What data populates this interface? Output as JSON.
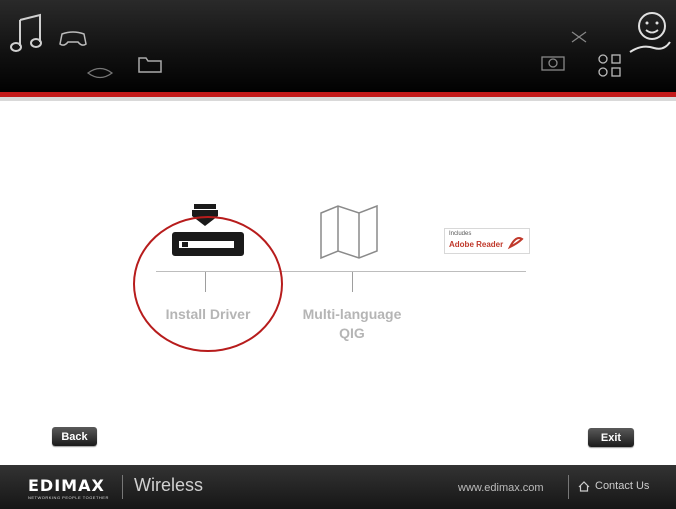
{
  "menu": {
    "items": [
      {
        "label": "Install Driver",
        "icon": "install-driver-icon",
        "selected": true
      },
      {
        "label": "Multi-language",
        "label2": "QIG",
        "icon": "folded-map-icon"
      },
      {
        "label": "Includes",
        "label2": "Adobe Reader",
        "icon": "adobe-reader-icon"
      }
    ]
  },
  "buttons": {
    "back": "Back",
    "exit": "Exit"
  },
  "footer": {
    "brand": "EDIMAX",
    "tagline": "NETWORKING PEOPLE TOGETHER",
    "product": "Wireless",
    "website": "www.edimax.com",
    "contact": "Contact Us"
  },
  "colors": {
    "accent": "#c41b1b",
    "highlight": "#b71c1c",
    "menu_text": "#b5b5b5"
  }
}
